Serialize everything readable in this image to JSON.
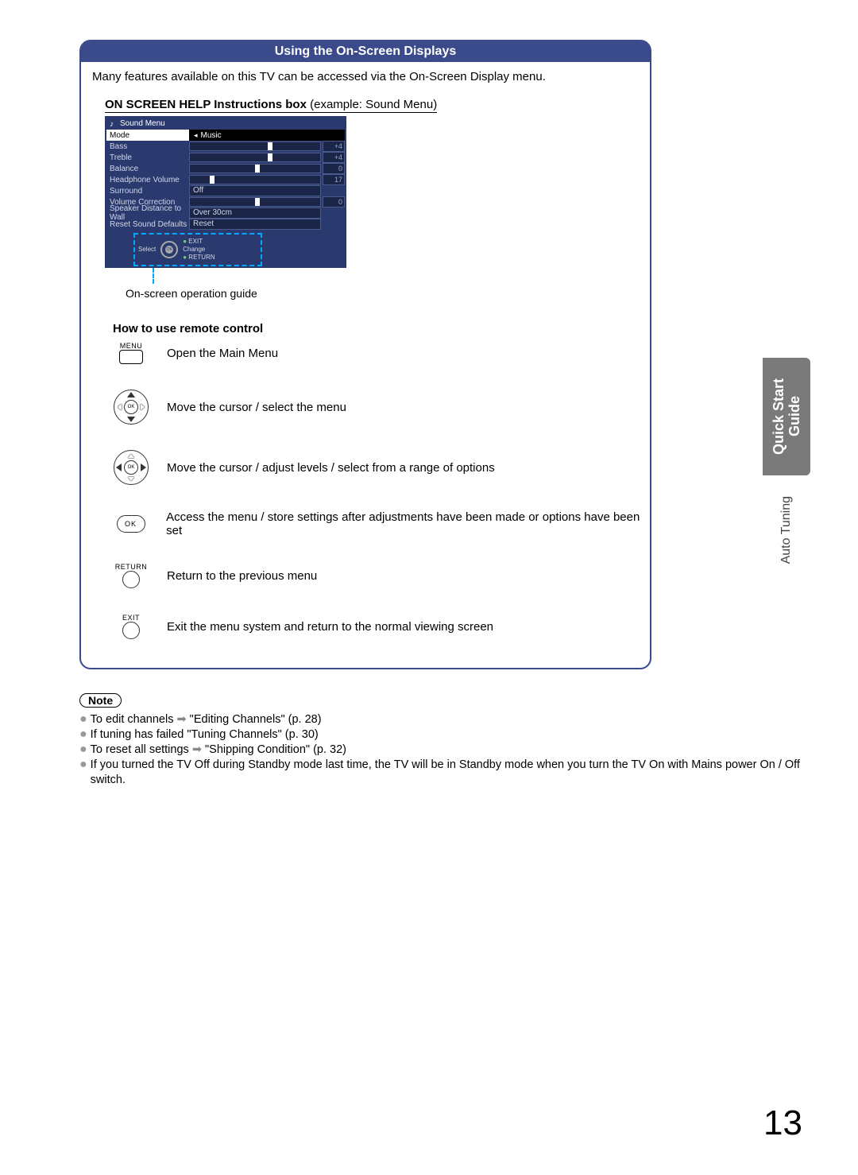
{
  "box_header": "Using the On-Screen Displays",
  "intro": "Many features available on this TV can be accessed via the On-Screen Display menu.",
  "help_heading_bold": "ON SCREEN HELP Instructions box",
  "help_heading_norm": " (example: Sound Menu)",
  "sound_menu": {
    "title": "Sound Menu",
    "mode_label": "Mode",
    "mode_value": "Music",
    "rows": [
      {
        "label": "Bass",
        "value": "+4",
        "thumb_pct": 60
      },
      {
        "label": "Treble",
        "value": "+4",
        "thumb_pct": 60
      },
      {
        "label": "Balance",
        "value": "0",
        "thumb_pct": 50
      },
      {
        "label": "Headphone Volume",
        "value": "17",
        "thumb_pct": 15
      },
      {
        "label": "Surround",
        "text": "Off"
      },
      {
        "label": "Volume Correction",
        "value": "0",
        "thumb_pct": 50
      },
      {
        "label": "Speaker Distance to Wall",
        "text": "Over 30cm"
      },
      {
        "label": "Reset Sound Defaults",
        "text": "Reset"
      }
    ],
    "guide": {
      "select": "Select",
      "exit": "EXIT",
      "change": "Change",
      "return": "RETURN",
      "ok": "OK"
    },
    "caption": "On-screen operation guide"
  },
  "howto_heading": "How to use remote control",
  "remote": {
    "menu_label": "MENU",
    "menu_desc": "Open the Main Menu",
    "dpad1_desc": "Move the cursor / select the menu",
    "dpad2_desc": "Move the cursor / adjust levels / select from a range of options",
    "ok_label": "OK",
    "ok_desc": "Access the menu / store settings after adjustments have been made or options have been set",
    "return_label": "RETURN",
    "return_desc": "Return to the previous menu",
    "exit_label": "EXIT",
    "exit_desc": "Exit the menu system and return to the normal viewing screen"
  },
  "note_label": "Note",
  "notes": {
    "n1a": "To edit channels ",
    "n1b": " \"Editing Channels\" (p. 28)",
    "n2": "If tuning has failed \"Tuning Channels\" (p. 30)",
    "n3a": "To reset all settings ",
    "n3b": " \"Shipping Condition\" (p. 32)",
    "n4": "If you turned the TV Off during Standby mode last time, the TV will be in Standby mode when you turn the TV On with Mains power On / Off switch."
  },
  "arrow": "➡",
  "side": {
    "qs_line1": "Quick Start",
    "qs_line2": "Guide",
    "at": "Auto Tuning"
  },
  "page_number": "13"
}
